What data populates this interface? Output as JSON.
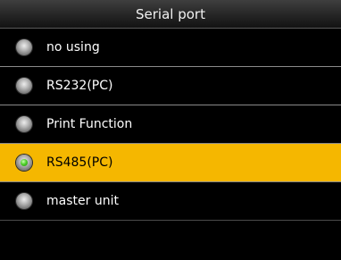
{
  "window": {
    "title": "Serial port"
  },
  "options": [
    {
      "label": "no using",
      "selected": false
    },
    {
      "label": "RS232(PC)",
      "selected": false
    },
    {
      "label": "Print Function",
      "selected": false
    },
    {
      "label": "RS485(PC)",
      "selected": true
    },
    {
      "label": "master unit",
      "selected": false
    }
  ],
  "colors": {
    "selection_highlight": "#f5b700",
    "background": "#000000",
    "selected_dot": "#4fd12a"
  }
}
